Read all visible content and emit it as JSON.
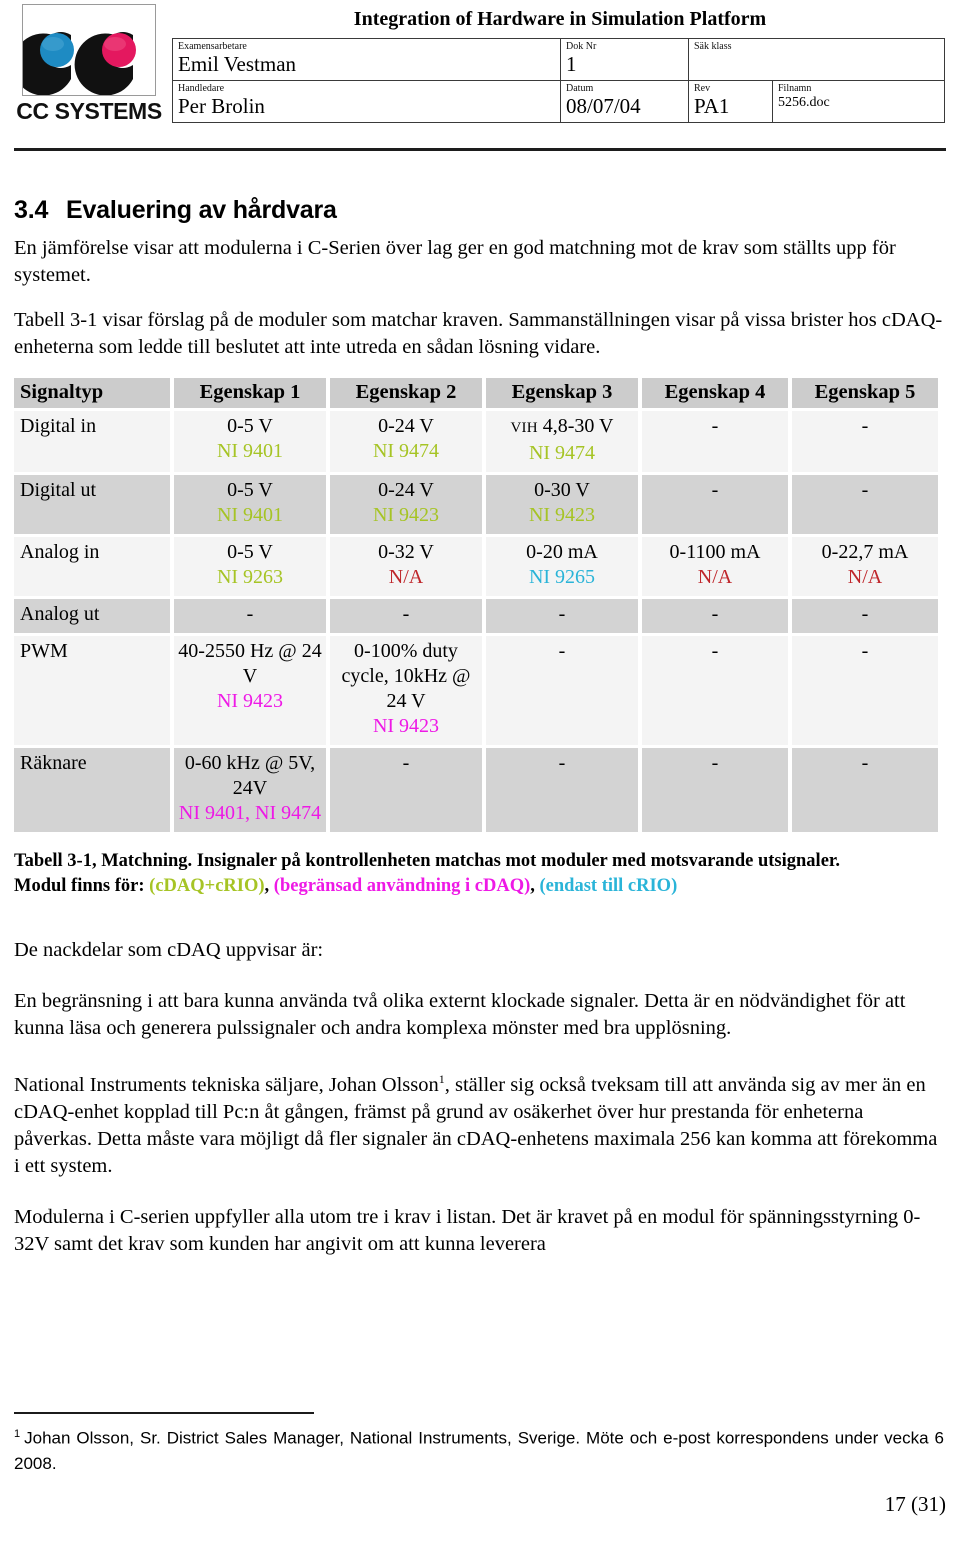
{
  "header": {
    "logo": {
      "wordmark": "CC SYSTEMS",
      "left_c_color": "#111111",
      "blue_disc": "#1e8bc3",
      "pink_disc": "#e4185f"
    },
    "document_title": "Integration of Hardware in Simulation Platform",
    "fields": {
      "examensarbetare_label": "Examensarbetare",
      "examensarbetare_value": "Emil Vestman",
      "dok_nr_label": "Dok Nr",
      "dok_nr_value": "1",
      "sak_klass_label": "Säk klass",
      "sak_klass_value": "",
      "handledare_label": "Handledare",
      "handledare_value": "Per Brolin",
      "datum_label": "Datum",
      "datum_value": "08/07/04",
      "rev_label": "Rev",
      "rev_value": "PA1",
      "filnamn_label": "Filnamn",
      "filnamn_value": "5256.doc"
    }
  },
  "section": {
    "number": "3.4",
    "title": "Evaluering av hårdvara",
    "paragraph_1": "En jämförelse visar att modulerna i C-Serien över lag ger en god matchning mot de krav som ställts upp för systemet.",
    "paragraph_2": "Tabell 3-1 visar förslag på de moduler som matchar kraven. Sammanställningen visar på vissa brister hos cDAQ-enheterna som ledde till beslutet att inte utreda en sådan lösning vidare."
  },
  "table": {
    "headers": [
      "Signaltyp",
      "Egenskap 1",
      "Egenskap 2",
      "Egenskap 3",
      "Egenskap 4",
      "Egenskap 5"
    ],
    "rows": [
      {
        "signal": "Digital in",
        "cells": [
          {
            "value": "0-5 V",
            "module": "NI 9401",
            "module_color": "green"
          },
          {
            "value": "0-24 V",
            "module": "NI 9474",
            "module_color": "green"
          },
          {
            "prefix": "VIH",
            "value": "4,8-30 V",
            "module": "NI 9474",
            "module_color": "green"
          },
          {
            "value": "-",
            "module": "",
            "module_color": ""
          },
          {
            "value": "-",
            "module": "",
            "module_color": ""
          }
        ]
      },
      {
        "signal": "Digital ut",
        "cells": [
          {
            "value": "0-5 V",
            "module": "NI 9401",
            "module_color": "green"
          },
          {
            "value": "0-24 V",
            "module": "NI 9423",
            "module_color": "green"
          },
          {
            "value": "0-30 V",
            "module": "NI 9423",
            "module_color": "green"
          },
          {
            "value": "-",
            "module": "",
            "module_color": ""
          },
          {
            "value": "-",
            "module": "",
            "module_color": ""
          }
        ]
      },
      {
        "signal": "Analog in",
        "cells": [
          {
            "value": "0-5 V",
            "module": "NI 9263",
            "module_color": "green"
          },
          {
            "value": "0-32 V",
            "module": "N/A",
            "module_color": "red"
          },
          {
            "value": "0-20 mA",
            "module": "NI 9265",
            "module_color": "cyan"
          },
          {
            "value": "0-1100 mA",
            "module": "N/A",
            "module_color": "red"
          },
          {
            "value": "0-22,7 mA",
            "module": "N/A",
            "module_color": "red"
          }
        ]
      },
      {
        "signal": "Analog ut",
        "cells": [
          {
            "value": "-",
            "module": "",
            "module_color": ""
          },
          {
            "value": "-",
            "module": "",
            "module_color": ""
          },
          {
            "value": "-",
            "module": "",
            "module_color": ""
          },
          {
            "value": "-",
            "module": "",
            "module_color": ""
          },
          {
            "value": "-",
            "module": "",
            "module_color": ""
          }
        ]
      },
      {
        "signal": "PWM",
        "cells": [
          {
            "value": "40-2550 Hz @ 24 V",
            "module": "NI 9423",
            "module_color": "magenta"
          },
          {
            "value": "0-100% duty cycle, 10kHz @ 24 V",
            "module": "NI 9423",
            "module_color": "magenta"
          },
          {
            "value": "-",
            "module": "",
            "module_color": ""
          },
          {
            "value": "-",
            "module": "",
            "module_color": ""
          },
          {
            "value": "-",
            "module": "",
            "module_color": ""
          }
        ]
      },
      {
        "signal": "Räknare",
        "cells": [
          {
            "value": "0-60 kHz @ 5V, 24V",
            "module": "NI 9401, NI 9474",
            "module_color": "magenta"
          },
          {
            "value": "-",
            "module": "",
            "module_color": ""
          },
          {
            "value": "-",
            "module": "",
            "module_color": ""
          },
          {
            "value": "-",
            "module": "",
            "module_color": ""
          },
          {
            "value": "-",
            "module": "",
            "module_color": ""
          }
        ]
      }
    ]
  },
  "caption": {
    "line1": "Tabell 3-1, Matchning. Insignaler på kontrollenheten matchas mot moduler med motsvarande utsignaler.",
    "line2_prefix": "Modul finns för:",
    "legend_green": "(cDAQ+cRIO)",
    "legend_magenta": "(begränsad användning i cDAQ)",
    "legend_cyan": "(endast till cRIO)",
    "sep": ","
  },
  "body": {
    "paragraph_3": "De nackdelar som cDAQ uppvisar är:",
    "paragraph_4": "En begränsning i att bara kunna använda två olika externt klockade signaler. Detta är en nödvändighet för att kunna läsa och generera pulssignaler och andra komplexa mönster med bra upplösning.",
    "paragraph_5_a": "National Instruments tekniska säljare, Johan Olsson",
    "paragraph_5_sup": "1",
    "paragraph_5_b": ", ställer sig också tveksam till att använda sig av mer än en cDAQ-enhet kopplad till Pc:n åt gången, främst på grund av osäkerhet över hur prestanda för enheterna påverkas. Detta måste vara möjligt då fler signaler än cDAQ-enhetens maximala 256 kan komma att förekomma i ett system.",
    "paragraph_6": "Modulerna i C-serien uppfyller alla utom tre i krav i listan. Det är kravet på en modul för spänningsstyrning 0-32V samt det krav som kunden har angivit om att kunna leverera"
  },
  "footnote": {
    "marker": "1",
    "text": "Johan Olsson, Sr. District Sales Manager, National Instruments, Sverige. Möte och e-post korrespondens under vecka 6 2008."
  },
  "footer": {
    "page": "17 (31)"
  },
  "colors": {
    "green": "#a6c425",
    "magenta": "#ee19e6",
    "cyan": "#2ab4d8",
    "red": "#bf262b",
    "header_row_bg": "#cccccc",
    "row_light_bg": "#f4f4f4",
    "row_dark_bg": "#d3d3d3"
  }
}
